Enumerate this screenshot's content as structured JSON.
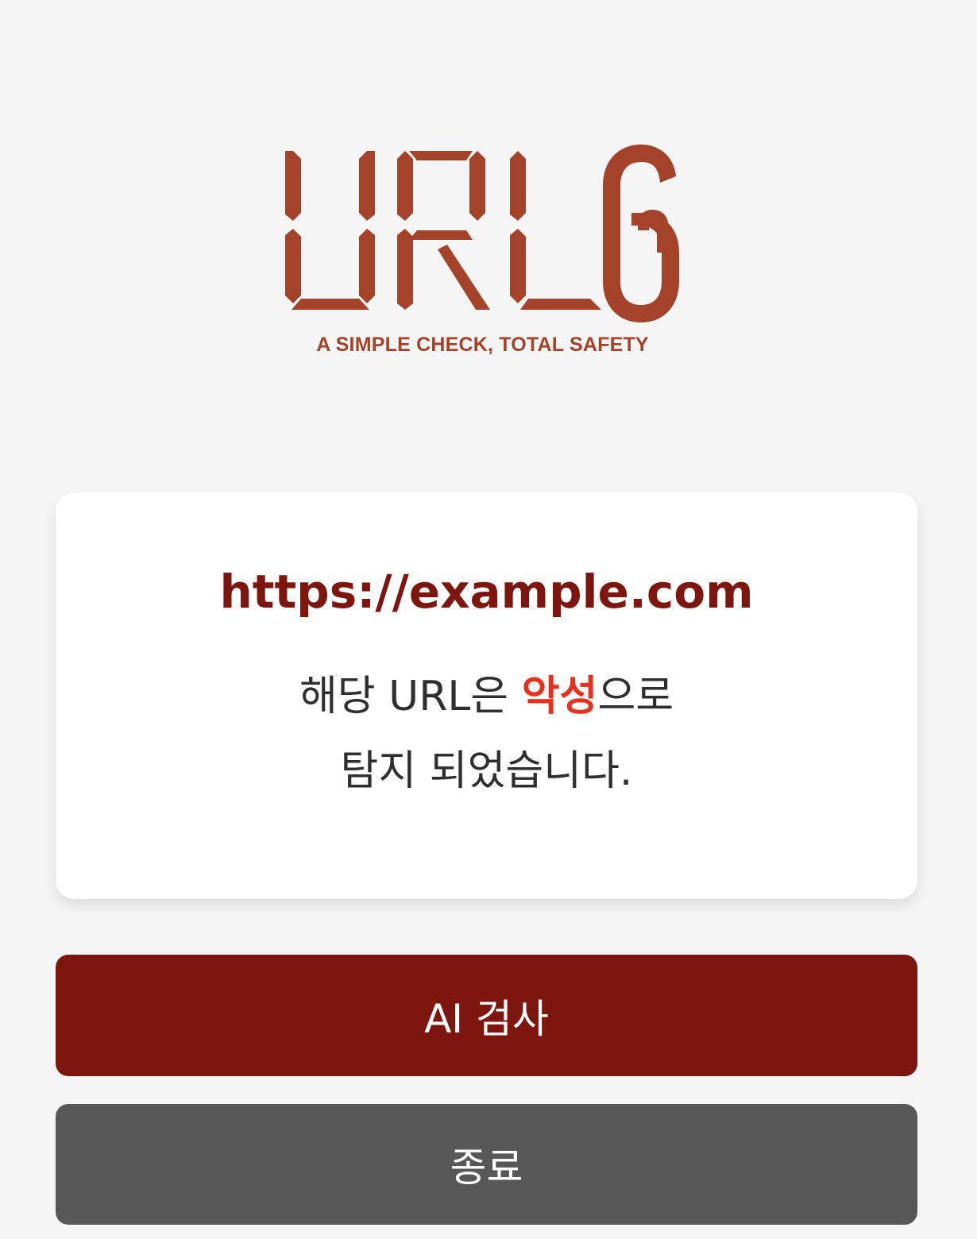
{
  "logo": {
    "wordmark": "URLG",
    "tagline": "A SIMPLE CHECK, TOTAL SAFETY",
    "color": "#a4432a"
  },
  "result": {
    "url": "https://example.com",
    "message_line1_prefix": "해당 URL은 ",
    "message_line1_highlight": "악성",
    "message_line1_suffix": "으로",
    "message_line2": "탐지 되었습니다.",
    "url_color": "#7e1610",
    "highlight_color": "#e4321f"
  },
  "buttons": {
    "ai_check_label": "AI 검사",
    "exit_label": "종료",
    "ai_check_color": "#7e1610",
    "exit_color": "#585858"
  },
  "background_color": "#f5f5f5"
}
